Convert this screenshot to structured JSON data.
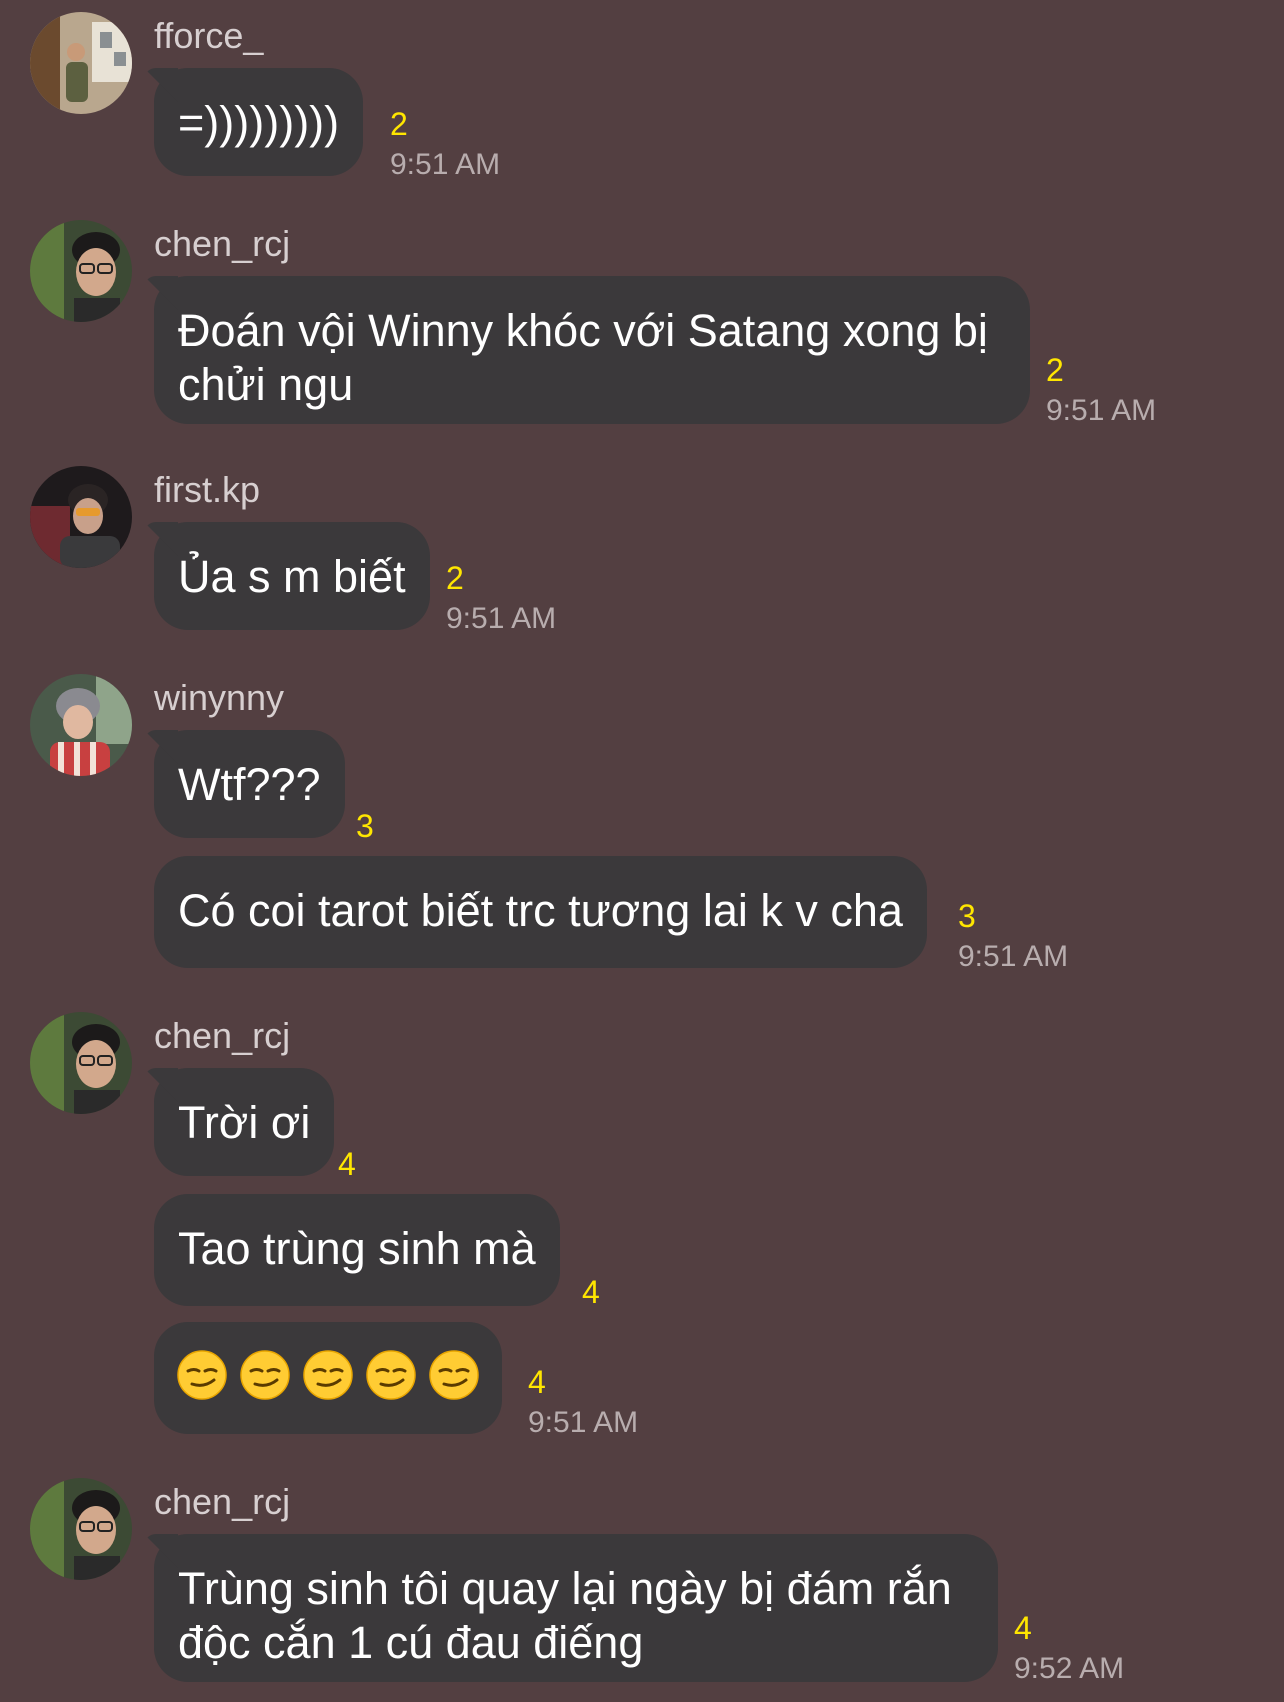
{
  "messages": [
    {
      "sender": "fforce_",
      "avatar": "avatar-fforce",
      "bubbles": [
        {
          "text": "=)))))))))",
          "read_count": "2",
          "time": "9:51 AM"
        }
      ]
    },
    {
      "sender": "chen_rcj",
      "avatar": "avatar-chen-rcj",
      "bubbles": [
        {
          "text": "Đoán vội Winny khóc với Satang xong bị chửi ngu",
          "read_count": "2",
          "time": "9:51 AM"
        }
      ]
    },
    {
      "sender": "first.kp",
      "avatar": "avatar-first-kp",
      "bubbles": [
        {
          "text": "Ủa s m biết",
          "read_count": "2",
          "time": "9:51 AM"
        }
      ]
    },
    {
      "sender": "winynny",
      "avatar": "avatar-winynny",
      "bubbles": [
        {
          "text": "Wtf???",
          "read_count": "3",
          "time": ""
        },
        {
          "text": "Có coi tarot biết trc tương lai k v cha",
          "read_count": "3",
          "time": "9:51 AM"
        }
      ]
    },
    {
      "sender": "chen_rcj",
      "avatar": "avatar-chen-rcj",
      "bubbles": [
        {
          "text": "Trời ơi",
          "read_count": "4",
          "time": ""
        },
        {
          "text": "Tao trùng sinh mà",
          "read_count": "4",
          "time": ""
        },
        {
          "emoji": [
            "smirking-face",
            "smirking-face",
            "smirking-face",
            "smirking-face",
            "smirking-face"
          ],
          "read_count": "4",
          "time": "9:51 AM"
        }
      ]
    },
    {
      "sender": "chen_rcj",
      "avatar": "avatar-chen-rcj",
      "bubbles": [
        {
          "text": "Trùng sinh tôi quay lại ngày bị đám rắn độc cắn 1 cú đau điếng",
          "read_count": "4",
          "time": "9:52 AM"
        }
      ]
    }
  ],
  "colors": {
    "background": "#533f41",
    "bubble": "#3b393b",
    "read_count": "#ffe600",
    "time": "#b8adae",
    "sender": "#d7cfd0"
  }
}
